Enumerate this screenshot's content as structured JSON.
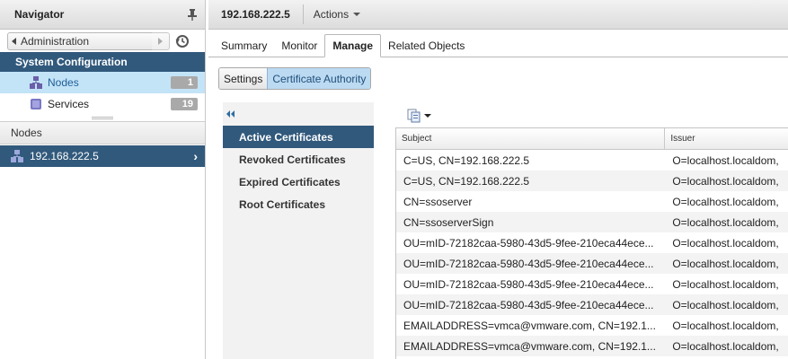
{
  "navigator": {
    "title": "Navigator",
    "back_label": "Administration",
    "section_title": "System Configuration",
    "items": [
      {
        "label": "Nodes",
        "count": "1",
        "icon": "nodes-icon"
      },
      {
        "label": "Services",
        "count": "19",
        "icon": "services-icon"
      }
    ],
    "list_header": "Nodes",
    "node": {
      "label": "192.168.222.5",
      "icon": "host-icon"
    }
  },
  "main": {
    "title": "192.168.222.5",
    "actions_label": "Actions",
    "tabs": [
      {
        "label": "Summary"
      },
      {
        "label": "Monitor"
      },
      {
        "label": "Manage"
      },
      {
        "label": "Related Objects"
      }
    ],
    "subtabs": [
      {
        "label": "Settings"
      },
      {
        "label": "Certificate Authority"
      }
    ],
    "cert_nav": [
      {
        "label": "Active Certificates"
      },
      {
        "label": "Revoked Certificates"
      },
      {
        "label": "Expired Certificates"
      },
      {
        "label": "Root Certificates"
      }
    ],
    "grid": {
      "headers": {
        "subject": "Subject",
        "issuer": "Issuer"
      },
      "rows": [
        {
          "subject": "C=US, CN=192.168.222.5",
          "issuer": "O=localhost.localdom,"
        },
        {
          "subject": "C=US, CN=192.168.222.5",
          "issuer": "O=localhost.localdom,"
        },
        {
          "subject": "CN=ssoserver",
          "issuer": "O=localhost.localdom,"
        },
        {
          "subject": "CN=ssoserverSign",
          "issuer": "O=localhost.localdom,"
        },
        {
          "subject": "OU=mID-72182caa-5980-43d5-9fee-210eca44ece...",
          "issuer": "O=localhost.localdom,"
        },
        {
          "subject": "OU=mID-72182caa-5980-43d5-9fee-210eca44ece...",
          "issuer": "O=localhost.localdom,"
        },
        {
          "subject": "OU=mID-72182caa-5980-43d5-9fee-210eca44ece...",
          "issuer": "O=localhost.localdom,"
        },
        {
          "subject": "OU=mID-72182caa-5980-43d5-9fee-210eca44ece...",
          "issuer": "O=localhost.localdom,"
        },
        {
          "subject": "EMAILADDRESS=vmca@vmware.com, CN=192.1...",
          "issuer": "O=localhost.localdom,"
        },
        {
          "subject": "EMAILADDRESS=vmca@vmware.com, CN=192.1...",
          "issuer": "O=localhost.localdom,"
        }
      ]
    }
  },
  "colors": {
    "selection_dark": "#31597c",
    "selection_light": "#c3e3f7",
    "badge": "#a9a9a9"
  }
}
